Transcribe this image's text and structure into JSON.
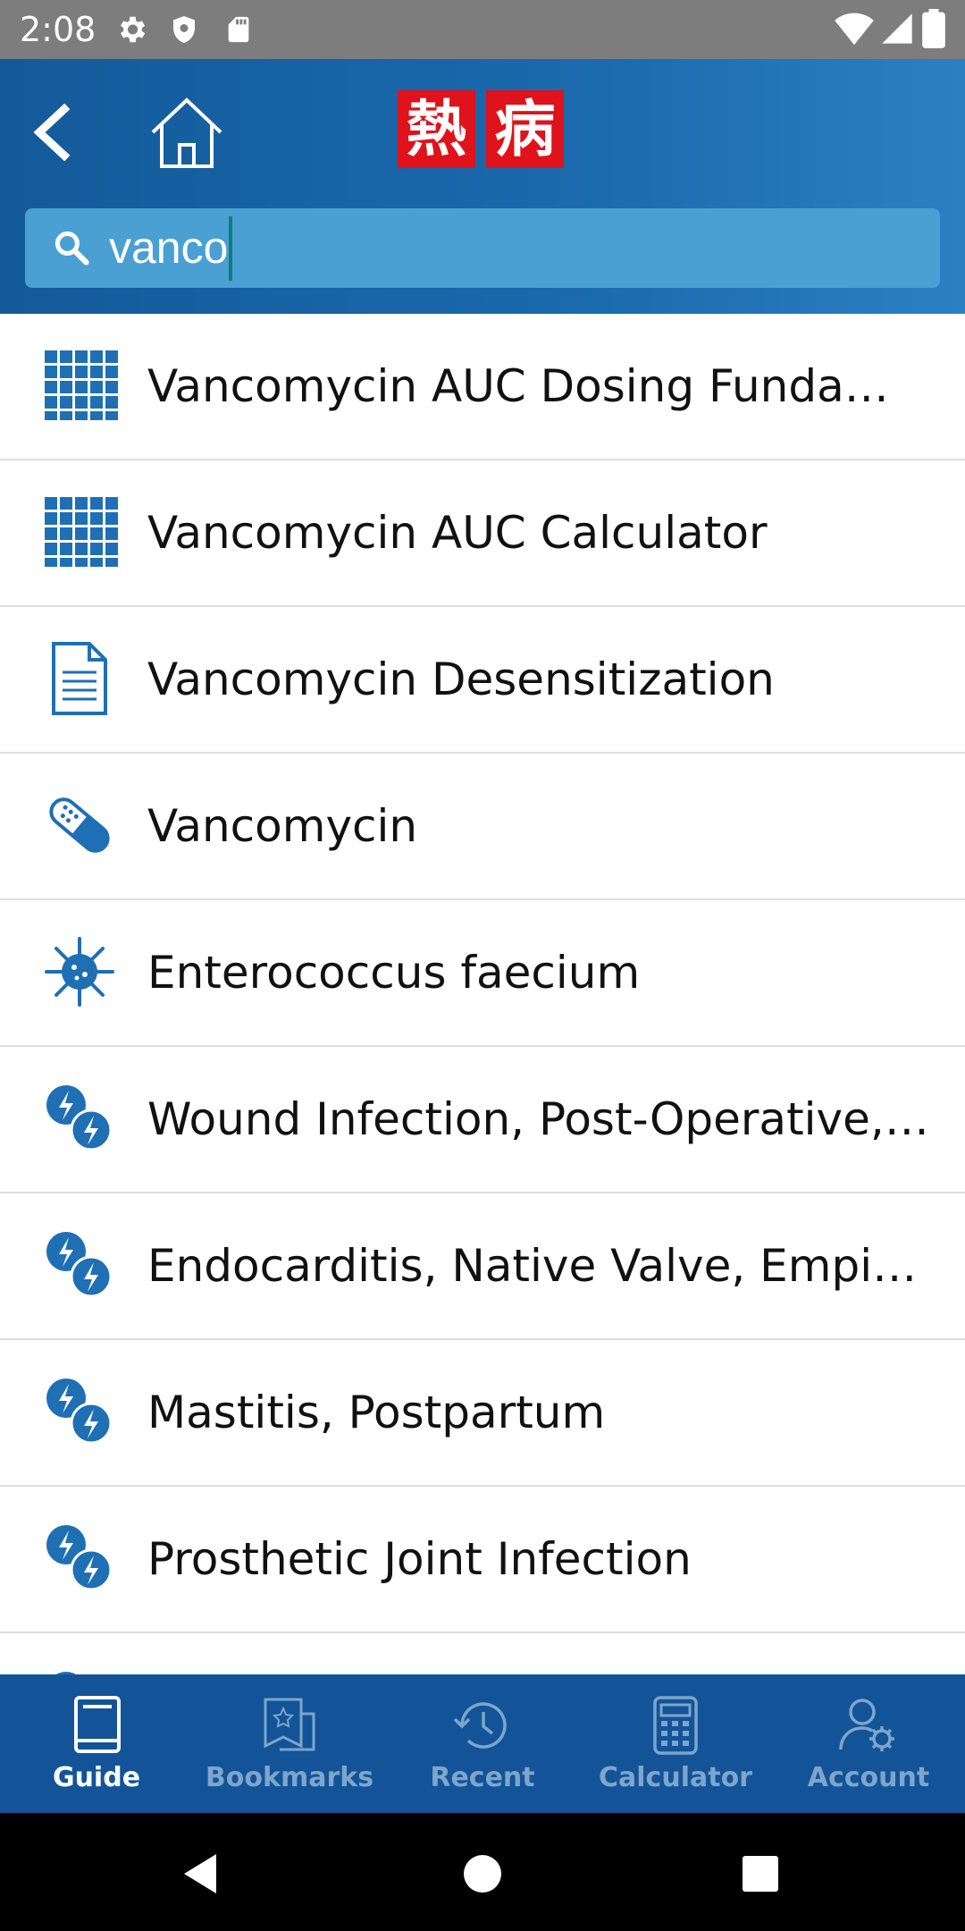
{
  "status_bar": {
    "time": "2:08",
    "left_icons": [
      "gear-icon",
      "shield-icon",
      "sd-card-icon"
    ],
    "right_icons": [
      "wifi-icon",
      "signal-icon",
      "battery-icon"
    ]
  },
  "header": {
    "logo_chars": [
      "熱",
      "病"
    ],
    "colors": {
      "bar": "#1a6aad",
      "logo": "#e0121b"
    }
  },
  "search": {
    "value": "vanco"
  },
  "results": [
    {
      "icon": "grid-calculator-icon",
      "label": "Vancomycin AUC Dosing Fundamen..."
    },
    {
      "icon": "grid-calculator-icon",
      "label": "Vancomycin AUC Calculator"
    },
    {
      "icon": "document-icon",
      "label": "Vancomycin Desensitization"
    },
    {
      "icon": "pill-icon",
      "label": "Vancomycin"
    },
    {
      "icon": "bacteria-icon",
      "label": "Enterococcus faecium"
    },
    {
      "icon": "lightning-pair-icon",
      "label": "Wound Infection, Post-Operative, Po..."
    },
    {
      "icon": "lightning-pair-icon",
      "label": "Endocarditis, Native Valve, Empiric T..."
    },
    {
      "icon": "lightning-pair-icon",
      "label": "Mastitis, Postpartum"
    },
    {
      "icon": "lightning-pair-icon",
      "label": "Prosthetic Joint Infection"
    },
    {
      "icon": "lightning-pair-icon",
      "label": ""
    }
  ],
  "tabs": [
    {
      "icon": "book-icon",
      "label": "Guide",
      "active": true
    },
    {
      "icon": "bookmarks-icon",
      "label": "Bookmarks",
      "active": false
    },
    {
      "icon": "history-icon",
      "label": "Recent",
      "active": false
    },
    {
      "icon": "calculator-icon",
      "label": "Calculator",
      "active": false
    },
    {
      "icon": "account-settings-icon",
      "label": "Account",
      "active": false
    }
  ]
}
